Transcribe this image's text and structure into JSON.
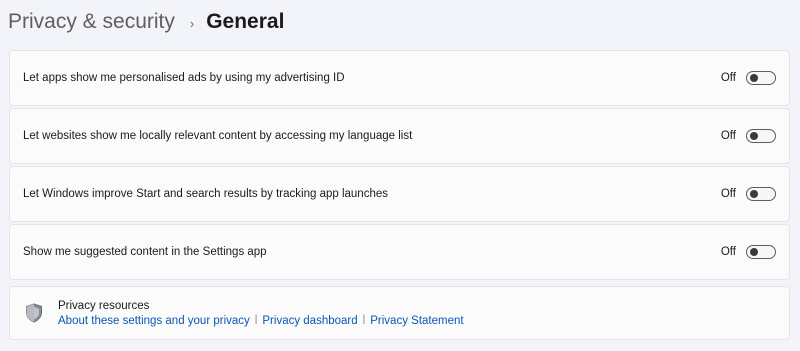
{
  "breadcrumb": {
    "parent": "Privacy & security",
    "separator": "›",
    "current": "General"
  },
  "settings": [
    {
      "label": "Let apps show me personalised ads by using my advertising ID",
      "state_label": "Off",
      "enabled": false
    },
    {
      "label": "Let websites show me locally relevant content by accessing my language list",
      "state_label": "Off",
      "enabled": false
    },
    {
      "label": "Let Windows improve Start and search results by tracking app launches",
      "state_label": "Off",
      "enabled": false
    },
    {
      "label": "Show me suggested content in the Settings app",
      "state_label": "Off",
      "enabled": false
    }
  ],
  "resources": {
    "title": "Privacy resources",
    "icon": "shield-icon",
    "links": [
      "About these settings and your privacy",
      "Privacy dashboard",
      "Privacy Statement"
    ],
    "link_divider": "|"
  },
  "colors": {
    "page_background": "#f3f4f9",
    "card_background": "#fbfbfc",
    "link": "#0a57b3"
  }
}
